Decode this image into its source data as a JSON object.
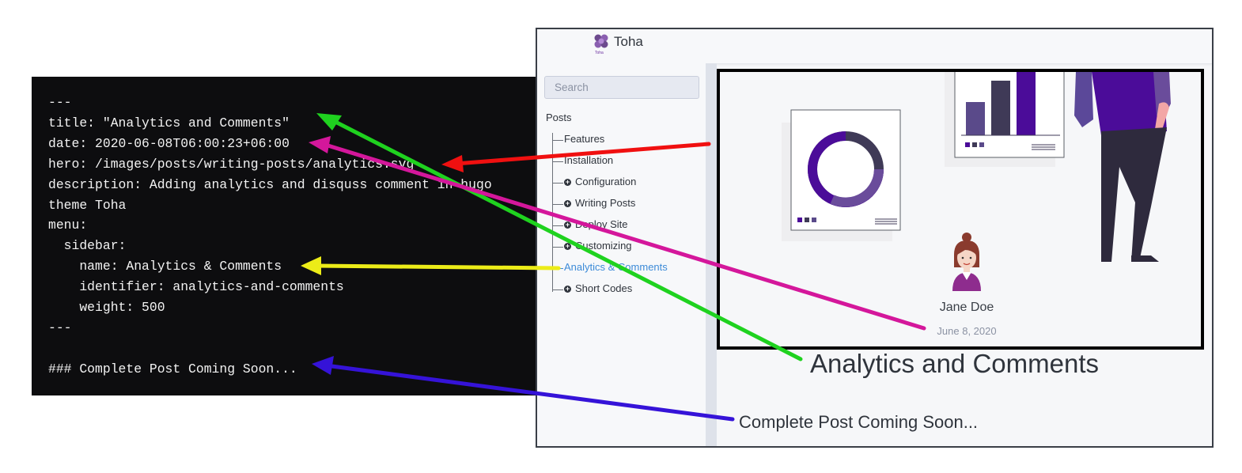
{
  "code": {
    "lines": [
      "---",
      "title: \"Analytics and Comments\"",
      "date: 2020-06-08T06:00:23+06:00",
      "hero: /images/posts/writing-posts/analytics.svg",
      "description: Adding analytics and disquss comment in hugo",
      "theme Toha",
      "menu:",
      "  sidebar:",
      "    name: Analytics & Comments",
      "    identifier: analytics-and-comments",
      "    weight: 500",
      "---",
      "",
      "### Complete Post Coming Soon..."
    ]
  },
  "site": {
    "brand": "Toha",
    "logo_caption": "Toha",
    "search_placeholder": "Search",
    "sidebar_section": "Posts",
    "sidebar_items": [
      {
        "label": "Features",
        "has_icon": false
      },
      {
        "label": "Installation",
        "has_icon": false
      },
      {
        "label": "Configuration",
        "has_icon": true
      },
      {
        "label": "Writing Posts",
        "has_icon": true
      },
      {
        "label": "Deploy Site",
        "has_icon": true
      },
      {
        "label": "Customizing",
        "has_icon": true
      },
      {
        "label": "Analytics & Comments",
        "has_icon": false,
        "active": true
      },
      {
        "label": "Short Codes",
        "has_icon": true
      }
    ],
    "author": "Jane Doe",
    "date": "June 8, 2020",
    "post_title": "Analytics and Comments",
    "post_body": "Complete Post Coming Soon..."
  },
  "colors": {
    "arrow_title": "#1fd21f",
    "arrow_date": "#d4179b",
    "arrow_hero": "#f01010",
    "arrow_menu": "#ecec18",
    "arrow_body": "#3513d8",
    "accent_purple": "#4b0c99",
    "active_link": "#3d8bd8"
  }
}
